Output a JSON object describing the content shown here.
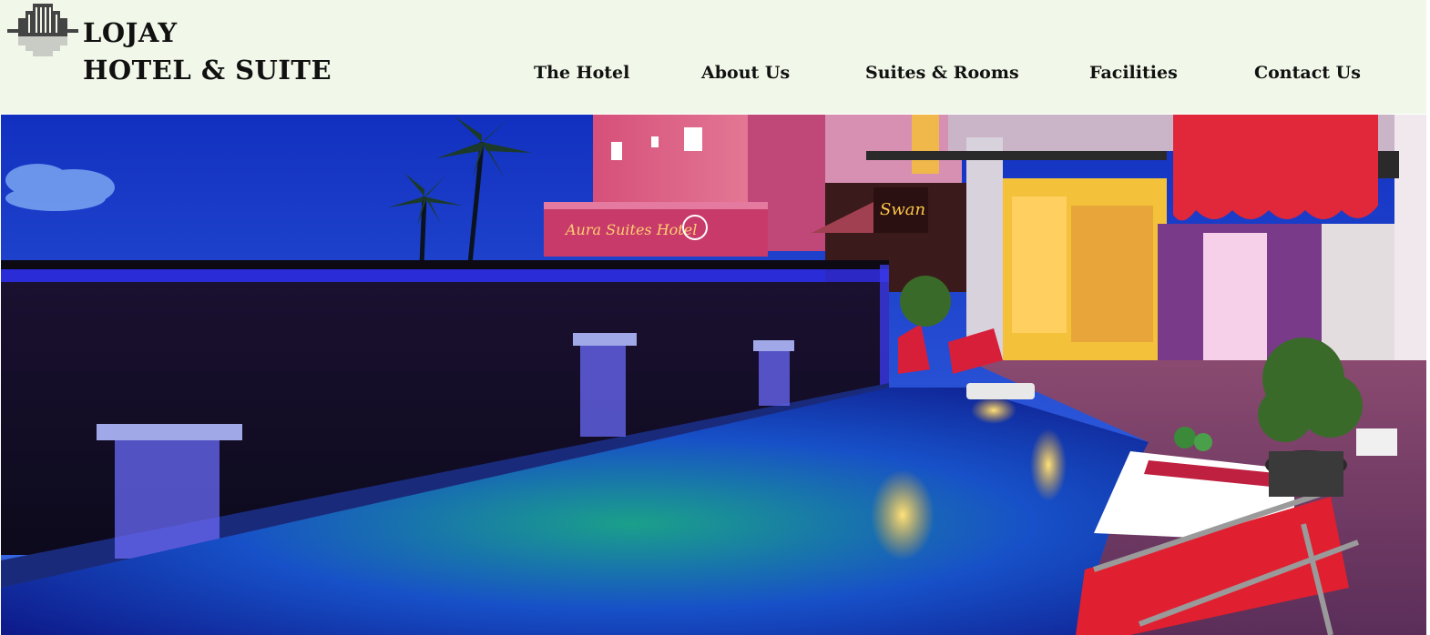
{
  "brand": {
    "name_line1": "LOJAY",
    "name_line2": "HOTEL & SUITE",
    "logo_icon": "building-skyline-icon"
  },
  "nav": {
    "items": [
      {
        "label": "The Hotel"
      },
      {
        "label": "About Us"
      },
      {
        "label": "Suites & Rooms"
      },
      {
        "label": "Facilities"
      },
      {
        "label": "Contact Us"
      }
    ]
  },
  "hero": {
    "sign_hotel": "Aura Suites Hotel",
    "sign_restaurant": "Swan"
  },
  "colors": {
    "header_bg": "#f1f8e9",
    "text": "#111111",
    "sky": "#1a3fd0",
    "pool": "#1f6fb8",
    "awning": "#e0283a"
  }
}
